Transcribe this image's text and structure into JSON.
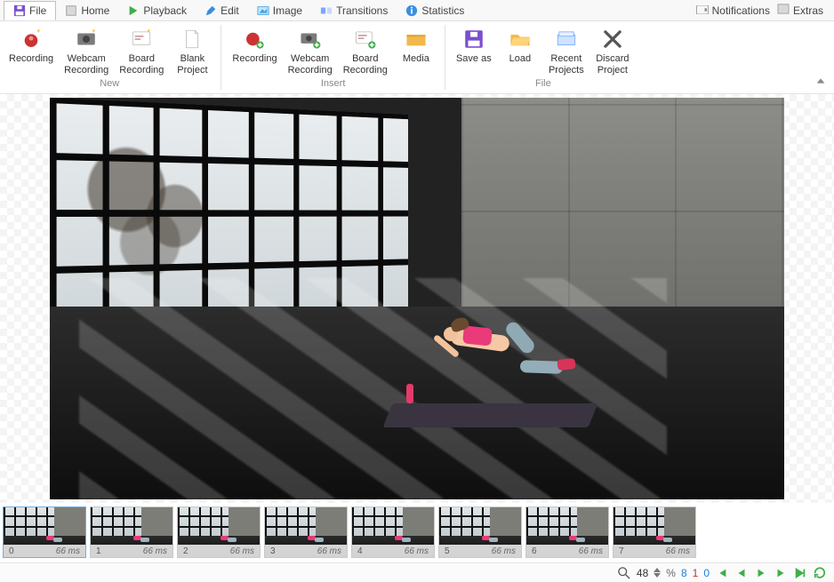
{
  "tabs": {
    "file": "File",
    "home": "Home",
    "playback": "Playback",
    "edit": "Edit",
    "image": "Image",
    "transitions": "Transitions",
    "statistics": "Statistics",
    "active": "file"
  },
  "topright": {
    "notifications": "Notifications",
    "extras": "Extras"
  },
  "ribbon": {
    "new": {
      "label": "New",
      "recording": "Recording",
      "webcam_recording": "Webcam\nRecording",
      "board_recording": "Board\nRecording",
      "blank_project": "Blank\nProject"
    },
    "insert": {
      "label": "Insert",
      "recording": "Recording",
      "webcam_recording": "Webcam\nRecording",
      "board_recording": "Board\nRecording",
      "media": "Media"
    },
    "file": {
      "label": "File",
      "save_as": "Save as",
      "load": "Load",
      "recent_projects": "Recent\nProjects",
      "discard_project": "Discard\nProject"
    }
  },
  "frames": [
    {
      "index": "0",
      "duration": "66 ms",
      "selected": true
    },
    {
      "index": "1",
      "duration": "66 ms",
      "selected": false
    },
    {
      "index": "2",
      "duration": "66 ms",
      "selected": false
    },
    {
      "index": "3",
      "duration": "66 ms",
      "selected": false
    },
    {
      "index": "4",
      "duration": "66 ms",
      "selected": false
    },
    {
      "index": "5",
      "duration": "66 ms",
      "selected": false
    },
    {
      "index": "6",
      "duration": "66 ms",
      "selected": false
    },
    {
      "index": "7",
      "duration": "66 ms",
      "selected": false
    }
  ],
  "status": {
    "zoom_value": "48",
    "percent": "%",
    "count_a": "8",
    "count_b": "1",
    "count_c": "0"
  }
}
